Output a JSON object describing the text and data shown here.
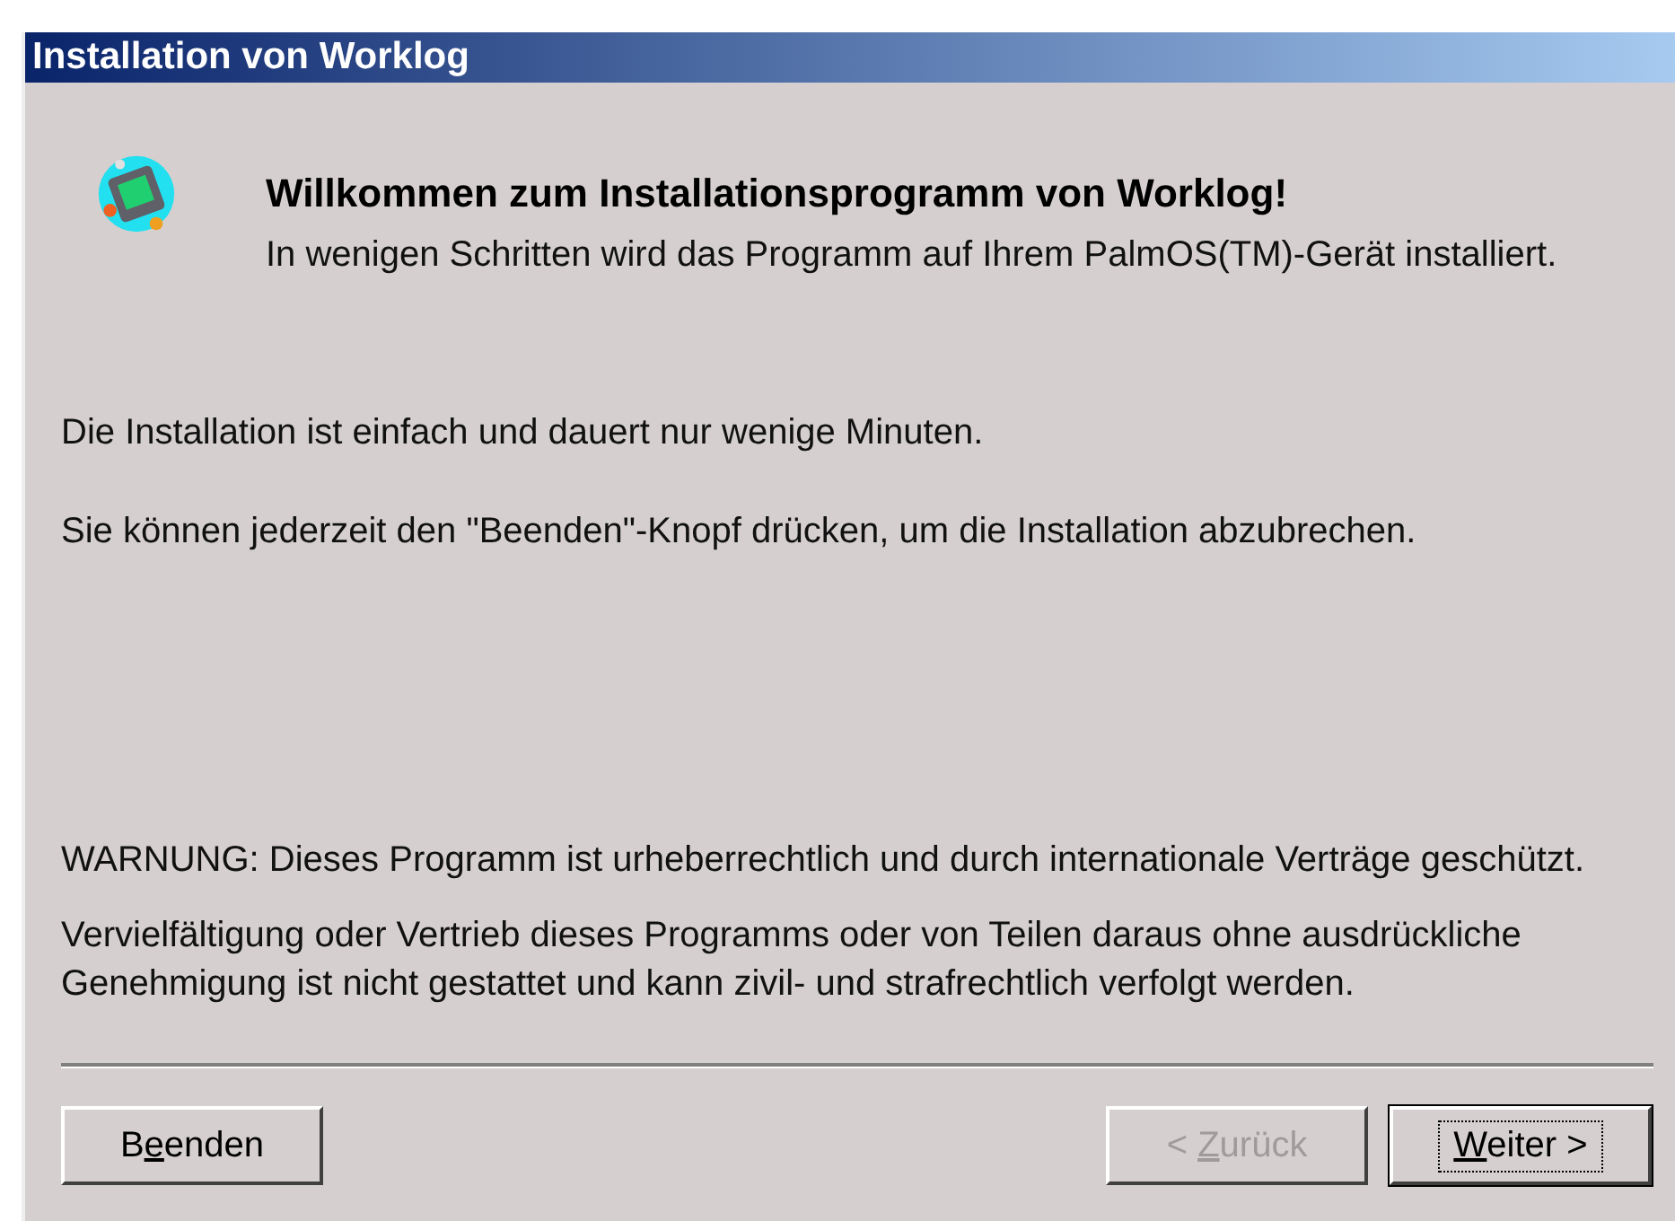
{
  "window": {
    "title": "Installation von Worklog"
  },
  "header": {
    "heading": "Willkommen zum Installationsprogramm von Worklog!",
    "subtitle": "In wenigen Schritten wird das Programm auf Ihrem PalmOS(TM)-Gerät installiert."
  },
  "intro": [
    "Die Installation ist einfach und dauert nur wenige Minuten.",
    "Sie können jederzeit den \"Beenden\"-Knopf drücken, um die Installation abzubrechen."
  ],
  "warning": [
    "WARNUNG: Dieses Programm ist urheberrechtlich und durch internationale Verträge geschützt.",
    "Vervielfältigung oder Vertrieb dieses Programms oder von Teilen daraus ohne ausdrückliche Genehmigung ist nicht gestattet und kann zivil- und strafrechtlich verfolgt werden."
  ],
  "buttons": [
    {
      "before": "B",
      "key": "e",
      "after": "enden",
      "disabled": false,
      "default": false
    },
    {
      "before": "< ",
      "key": "Z",
      "after": "urück",
      "disabled": true,
      "default": false
    },
    {
      "key": "W",
      "after": "eiter >",
      "disabled": false,
      "default": true
    }
  ]
}
